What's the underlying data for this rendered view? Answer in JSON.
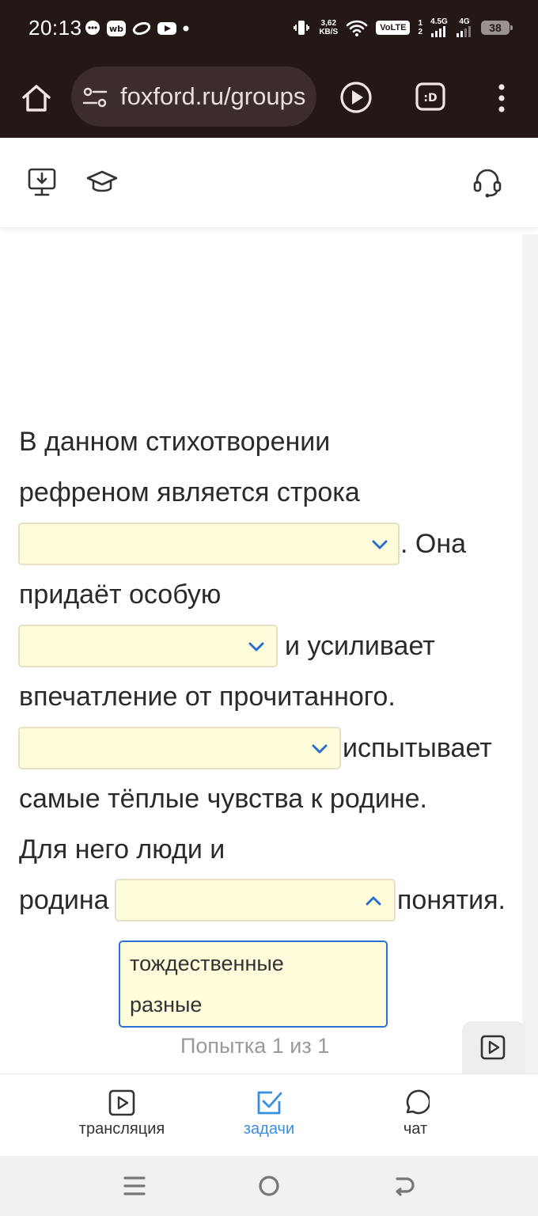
{
  "status_bar": {
    "time": "20:13",
    "app_icons": [
      "chat-bubble-icon",
      "wb-icon",
      "ring-icon",
      "youtube-icon",
      "dot-icon"
    ],
    "net_speed_value": "3,62",
    "net_speed_unit": "KB/S",
    "volte": "VoLTE",
    "sim1": "1",
    "sim2": "2",
    "net1": "4.5G",
    "net2": "4G",
    "battery": "38"
  },
  "browser": {
    "url": "foxford.ru/groups"
  },
  "question": {
    "lines": [
      "В данном стихотворении",
      "рефреном является строка",
      ". Она",
      "придаёт особую",
      "и усиливает",
      "впечатление от прочитанного.",
      "испытывает",
      "самые тёплые чувства к родине.",
      "Для него люди и",
      "родина",
      "понятия."
    ],
    "selects": [
      {
        "value": "",
        "state": "closed"
      },
      {
        "value": "",
        "state": "closed"
      },
      {
        "value": "",
        "state": "closed"
      },
      {
        "value": "",
        "state": "open"
      }
    ],
    "open_options": [
      "тождественные",
      "разные"
    ]
  },
  "attempt_text": "Попытка 1 из 1",
  "bottom_nav": [
    {
      "label": "трансляция",
      "icon": "play-square-icon",
      "active": false
    },
    {
      "label": "задачи",
      "icon": "checkbox-icon",
      "active": true
    },
    {
      "label": "чат",
      "icon": "chat-icon",
      "active": false
    }
  ],
  "colors": {
    "status_bg": "#241817",
    "select_bg": "#fffcdb",
    "accent_blue": "#3a8ee0",
    "dropdown_border": "#2e6fd3",
    "chevron": "#2a6fcf"
  }
}
